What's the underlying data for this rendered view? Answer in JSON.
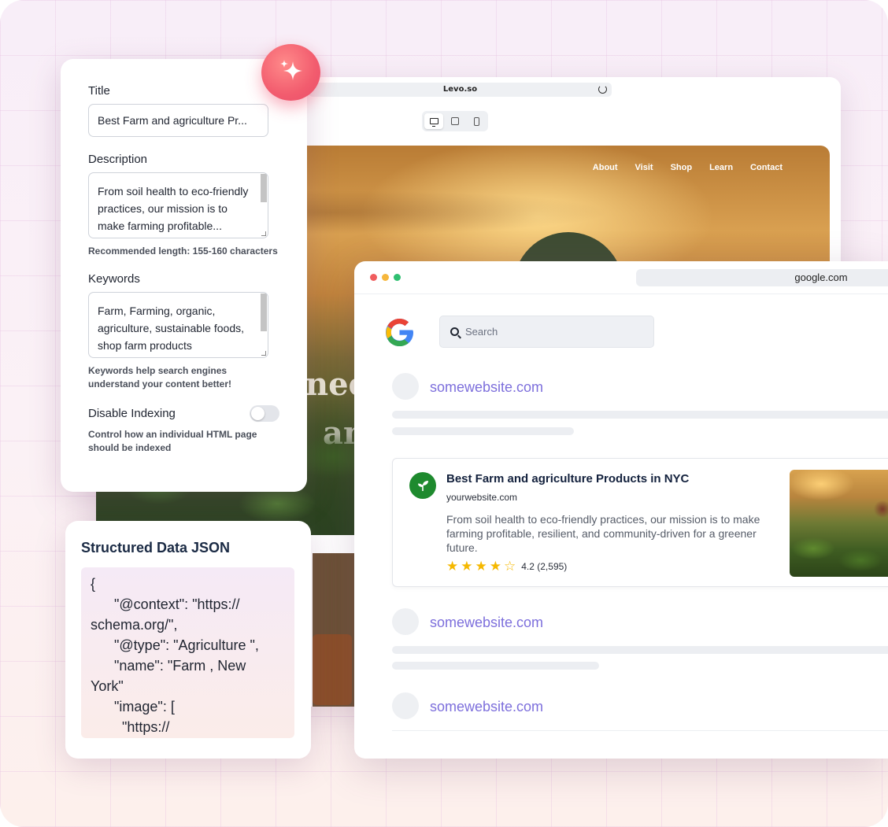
{
  "editor": {
    "url": "Levo.so",
    "nav": [
      "About",
      "Visit",
      "Shop",
      "Learn",
      "Contact"
    ],
    "hero_partial_1": "nee",
    "hero_partial_2": "an"
  },
  "seo": {
    "title_label": "Title",
    "title_value": "Best Farm and agriculture Pr...",
    "description_label": "Description",
    "description_value": "From soil health to eco-friendly practices, our mission is to make farming profitable...",
    "description_hint": "Recommended length: 155-160 characters",
    "keywords_label": "Keywords",
    "keywords_value": "Farm, Farming, organic, agriculture, sustainable foods, shop farm products",
    "keywords_hint": "Keywords help search engines understand your content better!",
    "indexing_label": "Disable Indexing",
    "indexing_enabled": false,
    "indexing_hint": "Control how an individual HTML page should be indexed"
  },
  "json_card": {
    "title": "Structured Data JSON",
    "code": "{\n      \"@context\": \"https://\nschema.org/\",\n      \"@type\": \"Agriculture \",\n      \"name\": \"Farm , New\nYork\"\n      \"image\": [\n        \"https://"
  },
  "google": {
    "url": "google.com",
    "search_placeholder": "Search",
    "results": [
      "somewebsite.com",
      "somewebsite.com",
      "somewebsite.com"
    ],
    "featured": {
      "title": "Best Farm and agriculture Products in NYC",
      "domain": "yourwebsite.com",
      "description": "From soil health to eco-friendly practices, our mission is to make farming profitable, resilient, and community-driven for a greener future.",
      "rating": 4.2,
      "rating_text": "4.2 (2,595)"
    }
  },
  "colors": {
    "accent_link": "#7d6fdc",
    "sparkle": "#f25c6e",
    "star": "#f5b800",
    "leaf_badge": "#1e8a2e"
  }
}
